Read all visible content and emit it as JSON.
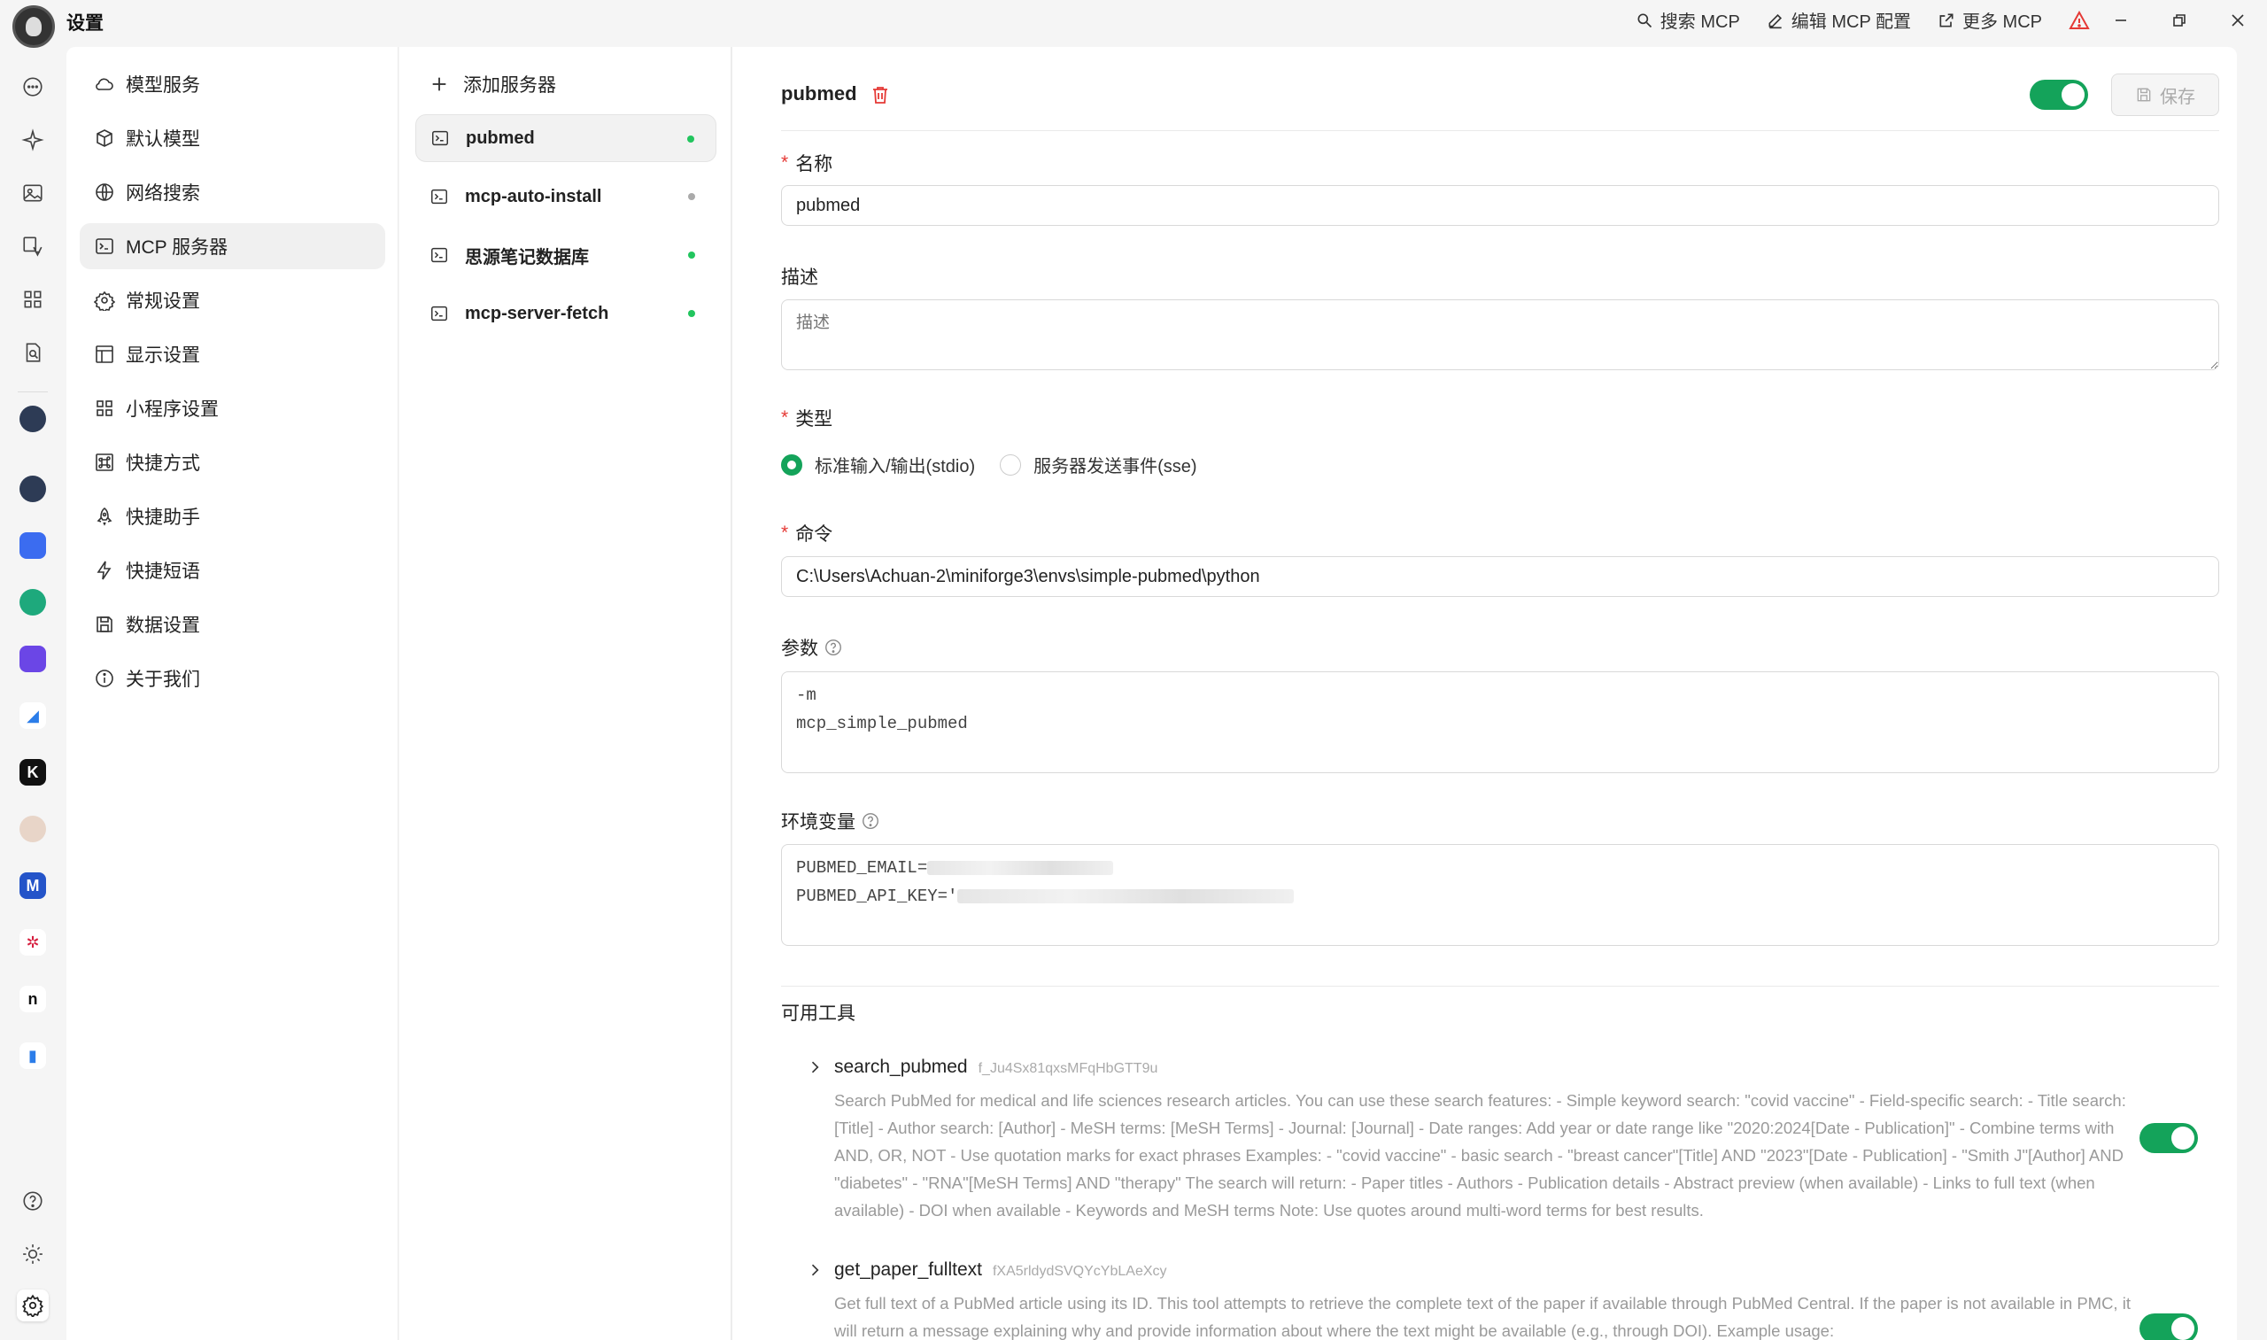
{
  "window": {
    "title": "设置"
  },
  "top_actions": {
    "search_mcp": "搜索 MCP",
    "edit_mcp_config": "编辑 MCP 配置",
    "more_mcp": "更多 MCP"
  },
  "colors": {
    "accent": "#14a35a",
    "danger": "#e53935",
    "status_on": "#22c55e",
    "status_off": "#aaaaaa"
  },
  "rail": {
    "icons": [
      "chat-icon",
      "sparkle-icon",
      "image-icon",
      "translate-icon",
      "apps-grid-icon",
      "file-search-icon"
    ],
    "apps": [
      "assistant-app-1",
      "assistant-app-2",
      "app-3",
      "app-4",
      "app-5",
      "app-6",
      "app-7",
      "app-8",
      "app-9",
      "app-10",
      "app-11",
      "app-12"
    ],
    "bottom_icons": [
      "help-icon",
      "sun-icon",
      "settings-icon"
    ]
  },
  "menu": {
    "items": [
      {
        "label": "模型服务",
        "icon": "cloud-icon"
      },
      {
        "label": "默认模型",
        "icon": "cube-icon"
      },
      {
        "label": "网络搜索",
        "icon": "globe-icon"
      },
      {
        "label": "MCP 服务器",
        "icon": "terminal-icon"
      },
      {
        "label": "常规设置",
        "icon": "gear-icon"
      },
      {
        "label": "显示设置",
        "icon": "layout-icon"
      },
      {
        "label": "小程序设置",
        "icon": "grid-icon"
      },
      {
        "label": "快捷方式",
        "icon": "command-icon"
      },
      {
        "label": "快捷助手",
        "icon": "rocket-icon"
      },
      {
        "label": "快捷短语",
        "icon": "zap-icon"
      },
      {
        "label": "数据设置",
        "icon": "save-icon"
      },
      {
        "label": "关于我们",
        "icon": "info-icon"
      }
    ]
  },
  "servers": {
    "add_label": "添加服务器",
    "items": [
      {
        "name": "pubmed",
        "active": true
      },
      {
        "name": "mcp-auto-install",
        "active": false
      },
      {
        "name": "思源笔记数据库",
        "active": true
      },
      {
        "name": "mcp-server-fetch",
        "active": true
      }
    ]
  },
  "detail": {
    "title": "pubmed",
    "enabled": true,
    "save_label": "保存",
    "name_label": "名称",
    "name_value": "pubmed",
    "desc_label": "描述",
    "desc_placeholder": "描述",
    "type_label": "类型",
    "type_options": [
      {
        "label": "标准输入/输出(stdio)",
        "checked": true
      },
      {
        "label": "服务器发送事件(sse)",
        "checked": false
      }
    ],
    "command_label": "命令",
    "command_value": "C:\\Users\\Achuan-2\\miniforge3\\envs\\simple-pubmed\\python",
    "args_label": "参数",
    "args_lines": [
      "-m",
      "mcp_simple_pubmed"
    ],
    "env_label": "环境变量",
    "env_lines": [
      "PUBMED_EMAIL=",
      "PUBMED_API_KEY='"
    ],
    "tools_title": "可用工具",
    "tools": [
      {
        "name": "search_pubmed",
        "id": "f_Ju4Sx81qxsMFqHbGTT9u",
        "enabled": true,
        "description": "Search PubMed for medical and life sciences research articles. You can use these search features: - Simple keyword search: \"covid vaccine\" - Field-specific search: - Title search: [Title] - Author search: [Author] - MeSH terms: [MeSH Terms] - Journal: [Journal] - Date ranges: Add year or date range like \"2020:2024[Date - Publication]\" - Combine terms with AND, OR, NOT - Use quotation marks for exact phrases Examples: - \"covid vaccine\" - basic search - \"breast cancer\"[Title] AND \"2023\"[Date - Publication] - \"Smith J\"[Author] AND \"diabetes\" - \"RNA\"[MeSH Terms] AND \"therapy\" The search will return: - Paper titles - Authors - Publication details - Abstract preview (when available) - Links to full text (when available) - DOI when available - Keywords and MeSH terms Note: Use quotes around multi-word terms for best results."
      },
      {
        "name": "get_paper_fulltext",
        "id": "fXA5rldydSVQYcYbLAeXcy",
        "enabled": true,
        "description": "Get full text of a PubMed article using its ID. This tool attempts to retrieve the complete text of the paper if available through PubMed Central. If the paper is not available in PMC, it will return a message explaining why and provide information about where the text might be available (e.g., through DOI). Example usage:"
      }
    ]
  }
}
